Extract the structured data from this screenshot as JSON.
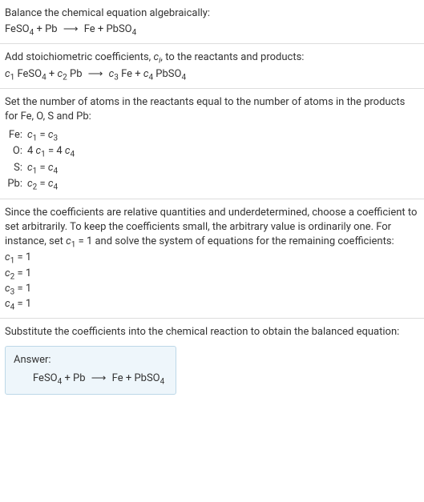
{
  "section1": {
    "line1": "Balance the chemical equation algebraically:",
    "eq_lhs1": "FeSO",
    "eq_lhs1_sub": "4",
    "plus": " + ",
    "eq_lhs2": "Pb",
    "arrow": "⟶",
    "eq_rhs1": "Fe + PbSO",
    "eq_rhs1_sub": "4"
  },
  "section2": {
    "line1_a": "Add stoichiometric coefficients, ",
    "ci": "c",
    "ci_sub": "i",
    "line1_b": ", to the reactants and products:",
    "c1": "c",
    "c1_sub": "1",
    "feso4": " FeSO",
    "feso4_sub": "4",
    "plus": " + ",
    "c2": "c",
    "c2_sub": "2",
    "pb": " Pb",
    "arrow": "⟶",
    "c3": "c",
    "c3_sub": "3",
    "fe": " Fe + ",
    "c4": "c",
    "c4_sub": "4",
    "pbso4": " PbSO",
    "pbso4_sub": "4"
  },
  "section3": {
    "intro": "Set the number of atoms in the reactants equal to the number of atoms in the products for Fe, O, S and Pb:",
    "rows": [
      {
        "elem": "Fe:",
        "lhs_c": "c",
        "lhs_sub": "1",
        "eq": " = ",
        "rhs_c": "c",
        "rhs_sub": "3",
        "lhs_mult": "",
        "rhs_mult": ""
      },
      {
        "elem": "O:",
        "lhs_c": "c",
        "lhs_sub": "1",
        "eq": " = 4 ",
        "rhs_c": "c",
        "rhs_sub": "4",
        "lhs_mult": "4 ",
        "rhs_mult": ""
      },
      {
        "elem": "S:",
        "lhs_c": "c",
        "lhs_sub": "1",
        "eq": " = ",
        "rhs_c": "c",
        "rhs_sub": "4",
        "lhs_mult": "",
        "rhs_mult": ""
      },
      {
        "elem": "Pb:",
        "lhs_c": "c",
        "lhs_sub": "2",
        "eq": " = ",
        "rhs_c": "c",
        "rhs_sub": "4",
        "lhs_mult": "",
        "rhs_mult": ""
      }
    ]
  },
  "section4": {
    "para_a": "Since the coefficients are relative quantities and underdetermined, choose a coefficient to set arbitrarily. To keep the coefficients small, the arbitrary value is ordinarily one. For instance, set ",
    "c1": "c",
    "c1_sub": "1",
    "para_b": " = 1 and solve the system of equations for the remaining coefficients:",
    "sol": [
      {
        "c": "c",
        "sub": "1",
        "val": " = 1"
      },
      {
        "c": "c",
        "sub": "2",
        "val": " = 1"
      },
      {
        "c": "c",
        "sub": "3",
        "val": " = 1"
      },
      {
        "c": "c",
        "sub": "4",
        "val": " = 1"
      }
    ]
  },
  "section5": {
    "intro": "Substitute the coefficients into the chemical reaction to obtain the balanced equation:",
    "answer_label": "Answer:",
    "feso4": "FeSO",
    "feso4_sub": "4",
    "plus": " + Pb",
    "arrow": "⟶",
    "rhs": "Fe + PbSO",
    "rhs_sub": "4"
  }
}
